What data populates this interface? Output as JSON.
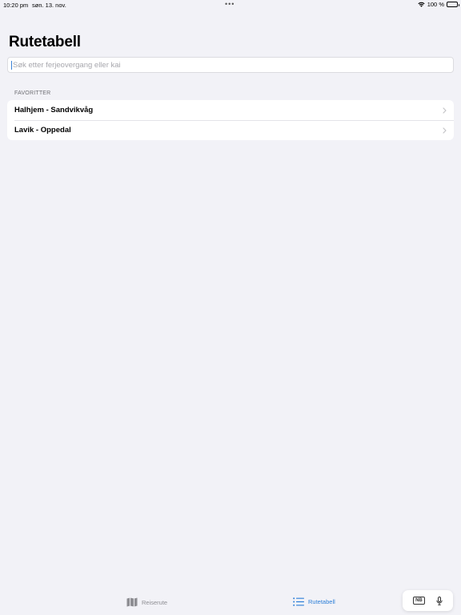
{
  "status_bar": {
    "time": "10:20 pm",
    "date": "søn. 13. nov.",
    "dots": "•••",
    "battery_text": "100 %"
  },
  "page": {
    "title": "Rutetabell"
  },
  "search": {
    "placeholder": "Søk etter ferjeovergang eller kai",
    "value": ""
  },
  "favorites": {
    "header": "FAVORITTER",
    "items": [
      {
        "label": "Halhjem - Sandvikvåg"
      },
      {
        "label": "Lavik - Oppedal"
      }
    ]
  },
  "tab_bar": {
    "tabs": [
      {
        "label": "Reiserute",
        "icon": "map-icon",
        "active": false
      },
      {
        "label": "Rutetabell",
        "icon": "list-icon",
        "active": true
      }
    ]
  },
  "keyboard_assistant": {
    "language_label": "NB",
    "mic_icon": "mic-icon"
  },
  "colors": {
    "background": "#f2f2f7",
    "accent": "#2f80d8",
    "inactive": "#8e8e93"
  }
}
